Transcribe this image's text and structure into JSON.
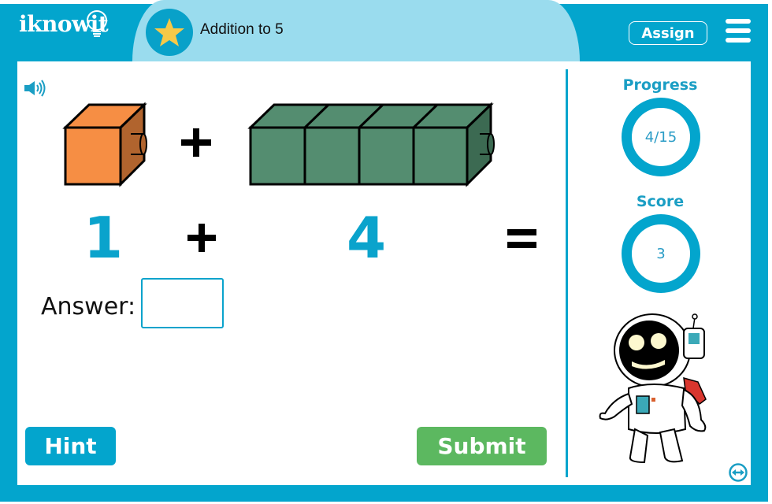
{
  "header": {
    "logo_text": "iknowit",
    "lesson_title": "Addition to 5",
    "assign_label": "Assign",
    "menu_icon": "hamburger-menu-icon",
    "lesson_icon": "star-icon"
  },
  "problem": {
    "sound_icon": "speaker-icon",
    "blocks_group_a": {
      "count": 1,
      "color": "#f68e44"
    },
    "blocks_group_b": {
      "count": 4,
      "color": "#548d70"
    },
    "operand_a": "1",
    "operator": "+",
    "operand_b": "4",
    "equals": "=",
    "answer_label": "Answer:",
    "answer_value": "",
    "answer_placeholder": ""
  },
  "buttons": {
    "hint_label": "Hint",
    "submit_label": "Submit"
  },
  "sidebar": {
    "progress_label": "Progress",
    "progress_value": "4/15",
    "score_label": "Score",
    "score_value": "3",
    "mascot": "astronaut-mascot",
    "toggle_icon": "swap-horizontal-icon"
  },
  "colors": {
    "brand_blue": "#03a5cd",
    "title_pill": "#9adcee",
    "number_blue": "#0aa3cc",
    "submit_green": "#5cb860",
    "star_yellow": "#f6c948"
  }
}
